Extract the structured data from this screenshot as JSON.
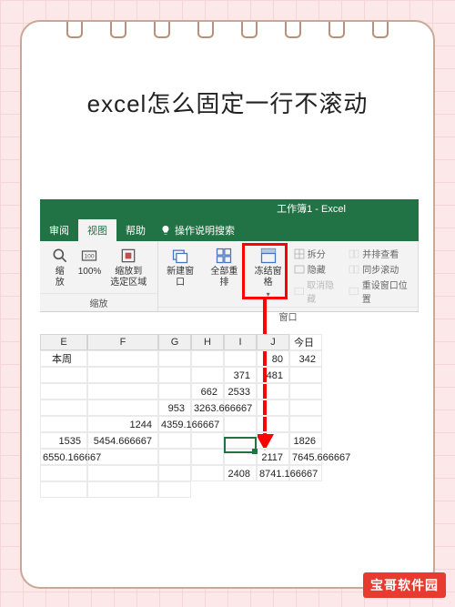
{
  "page_title": "excel怎么固定一行不滚动",
  "window_title": "工作簿1 - Excel",
  "tabs": {
    "review": "审阅",
    "view": "视图",
    "help": "帮助",
    "tellme": "操作说明搜索"
  },
  "ribbon": {
    "zoom_group": "缩放",
    "zoom": "缩\n放",
    "zoom100": "100%",
    "zoom_sel": "缩放到\n选定区域",
    "window_group": "窗口",
    "new_window": "新建窗口",
    "arrange": "全部重排",
    "freeze": "冻结窗格",
    "split": "拆分",
    "hide": "隐藏",
    "unhide": "取消隐藏",
    "side_by_side": "并排查看",
    "sync_scroll": "同步滚动",
    "reset_pos": "重设窗口位置"
  },
  "columns": [
    "E",
    "F",
    "G",
    "H",
    "I",
    "J"
  ],
  "rows": [
    {
      "e": "今日",
      "f": "本周"
    },
    {
      "e": "80",
      "f": "342"
    },
    {
      "e": "371",
      "f": "481"
    },
    {
      "e": "662",
      "f": "2533"
    },
    {
      "e": "953",
      "f": "3263.666667"
    },
    {
      "e": "1244",
      "f": "4359.166667"
    },
    {
      "e": "1535",
      "f": "5454.666667"
    },
    {
      "e": "1826",
      "f": "6550.166667"
    },
    {
      "e": "2117",
      "f": "7645.666667"
    },
    {
      "e": "2408",
      "f": "8741.166667"
    }
  ],
  "watermark": "宝哥软件园"
}
